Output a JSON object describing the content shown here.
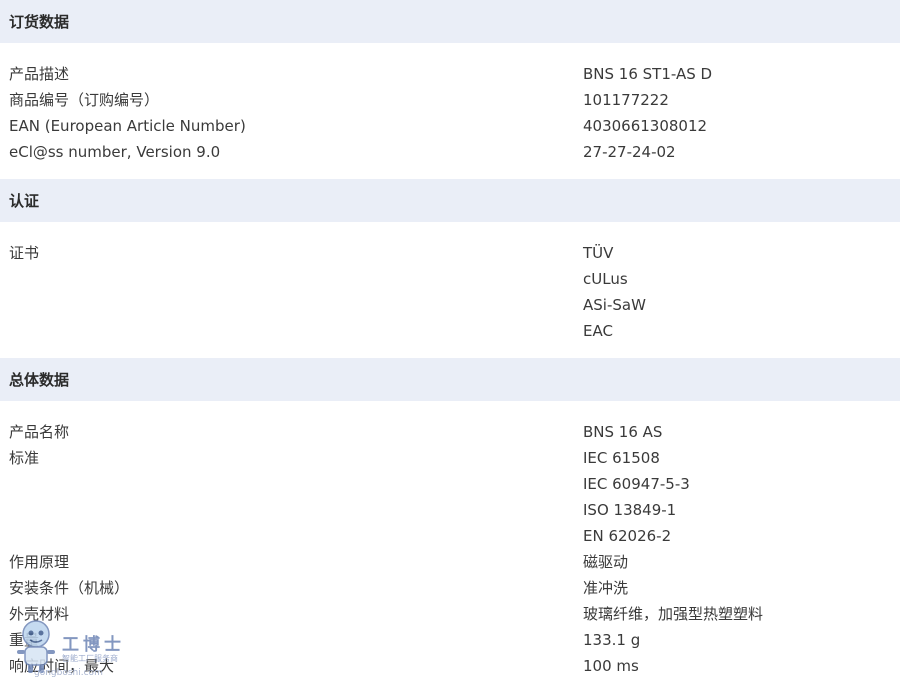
{
  "sections": [
    {
      "title": "订货数据",
      "rows": [
        {
          "label": "产品描述",
          "values": [
            "BNS 16 ST1-AS D"
          ]
        },
        {
          "label": "商品编号（订购编号）",
          "values": [
            "101177222"
          ]
        },
        {
          "label": "EAN (European Article Number)",
          "values": [
            "4030661308012"
          ]
        },
        {
          "label": "eCl@ss number, Version 9.0",
          "values": [
            "27-27-24-02"
          ]
        }
      ]
    },
    {
      "title": "认证",
      "rows": [
        {
          "label": "证书",
          "values": [
            "TÜV",
            "cULus",
            "ASi-SaW",
            "EAC"
          ]
        }
      ]
    },
    {
      "title": "总体数据",
      "rows": [
        {
          "label": "产品名称",
          "values": [
            "BNS 16 AS"
          ]
        },
        {
          "label": "标准",
          "values": [
            "IEC 61508",
            "IEC 60947-5-3",
            "ISO 13849-1",
            "EN 62026-2"
          ]
        },
        {
          "label": "作用原理",
          "values": [
            "磁驱动"
          ]
        },
        {
          "label": "安装条件（机械）",
          "values": [
            "准冲洗"
          ]
        },
        {
          "label": "外壳材料",
          "values": [
            "玻璃纤维，加强型热塑塑料"
          ]
        },
        {
          "label": "重量",
          "values": [
            "133.1 g"
          ]
        },
        {
          "label": "响应时间，最大",
          "values": [
            "100 ms"
          ]
        }
      ]
    }
  ],
  "watermark": {
    "title": "工博士",
    "subtitle": "智能工厂服务商",
    "url": "gongboshi.com",
    "icon": "robot-mascot-icon"
  },
  "colors": {
    "section_header_bg": "#eaeef7",
    "text": "#3a3a3a"
  }
}
